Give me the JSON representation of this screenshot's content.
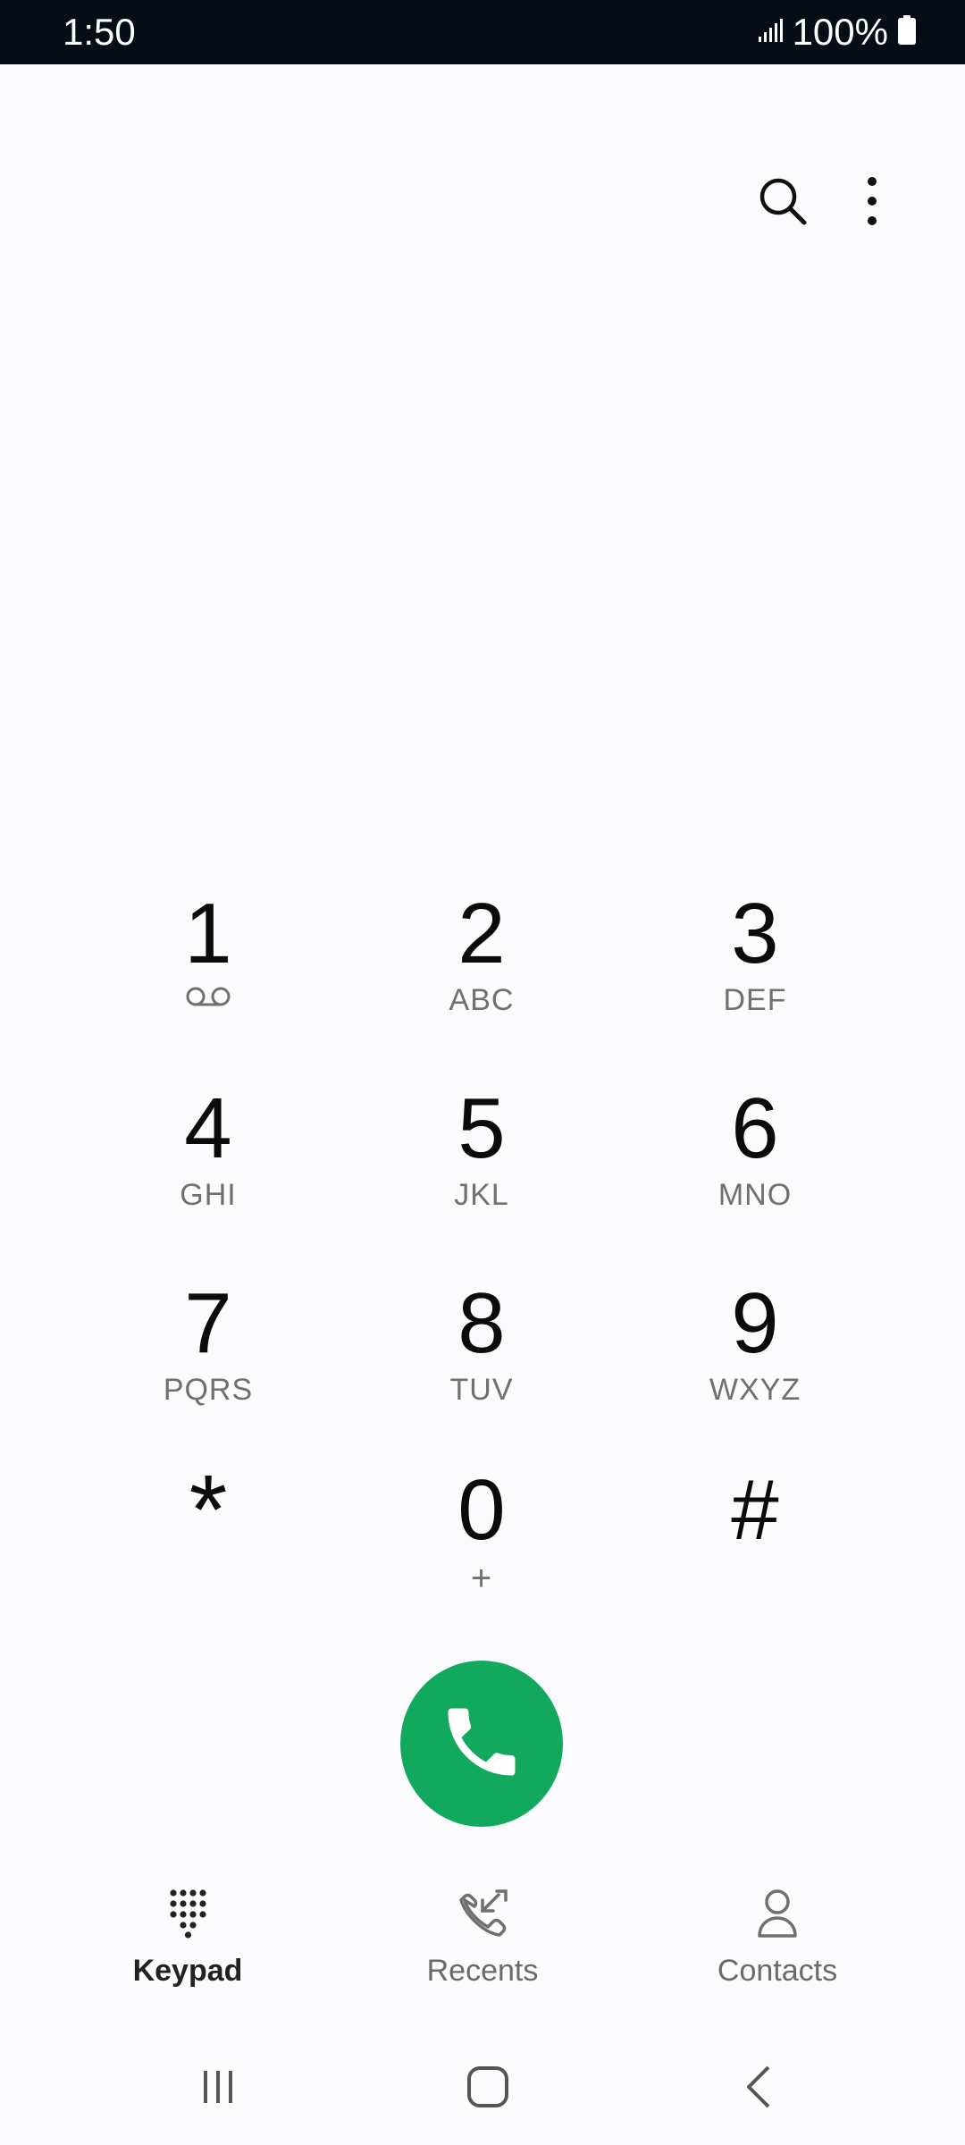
{
  "status_bar": {
    "time": "1:50",
    "battery_percent": "100%",
    "signal_icon": "signal-icon",
    "battery_icon": "battery-icon"
  },
  "toolbar": {
    "search_icon": "search-icon",
    "more_icon": "more-options-icon"
  },
  "keypad": {
    "keys": [
      {
        "digit": "1",
        "letters": "",
        "sub_icon": "voicemail-icon"
      },
      {
        "digit": "2",
        "letters": "ABC"
      },
      {
        "digit": "3",
        "letters": "DEF"
      },
      {
        "digit": "4",
        "letters": "GHI"
      },
      {
        "digit": "5",
        "letters": "JKL"
      },
      {
        "digit": "6",
        "letters": "MNO"
      },
      {
        "digit": "7",
        "letters": "PQRS"
      },
      {
        "digit": "8",
        "letters": "TUV"
      },
      {
        "digit": "9",
        "letters": "WXYZ"
      },
      {
        "digit": "*",
        "letters": ""
      },
      {
        "digit": "0",
        "letters": "+"
      },
      {
        "digit": "#",
        "letters": ""
      }
    ]
  },
  "call_button": {
    "icon": "phone-icon",
    "color": "#12a85e"
  },
  "bottom_nav": {
    "tabs": [
      {
        "label": "Keypad",
        "icon": "keypad-icon",
        "active": true
      },
      {
        "label": "Recents",
        "icon": "recents-icon",
        "active": false
      },
      {
        "label": "Contacts",
        "icon": "contacts-icon",
        "active": false
      }
    ]
  },
  "system_nav": {
    "recent_apps_icon": "recent-apps-icon",
    "home_icon": "home-icon",
    "back_icon": "back-icon"
  }
}
